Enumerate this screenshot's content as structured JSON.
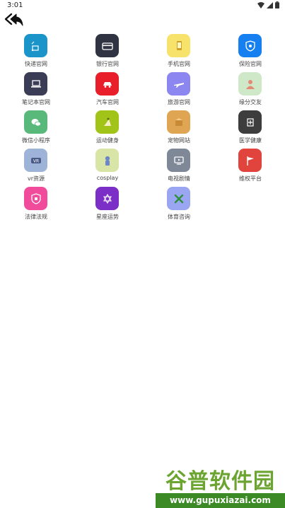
{
  "statusbar": {
    "time": "3:01"
  },
  "colors": {
    "accent_green": "#6ca431",
    "watermark_bar": "#3c8a26"
  },
  "grid": {
    "rows": [
      [
        {
          "label": "快递官网",
          "icon": "delivery-icon",
          "color": "#1b95c9"
        },
        {
          "label": "银行官网",
          "icon": "card-icon",
          "color": "#2f3342"
        },
        {
          "label": "手机官网",
          "icon": "phone-icon",
          "color": "#f7e36b"
        },
        {
          "label": "保险官网",
          "icon": "shield-icon",
          "color": "#1680f0"
        }
      ],
      [
        {
          "label": "笔记本官网",
          "icon": "laptop-icon",
          "color": "#3a3d55"
        },
        {
          "label": "汽车官网",
          "icon": "car-icon",
          "color": "#e81f2a"
        },
        {
          "label": "旅游官网",
          "icon": "plane-icon",
          "color": "#8b86f0"
        },
        {
          "label": "缘分交友",
          "icon": "friends-icon",
          "color": "#cfe8c8"
        }
      ],
      [
        {
          "label": "微信小程序",
          "icon": "wechat-icon",
          "color": "#59b97a"
        },
        {
          "label": "运动健身",
          "icon": "fitness-icon",
          "color": "#a2c318"
        },
        {
          "label": "宠物网站",
          "icon": "pet-icon",
          "color": "#e0a552"
        },
        {
          "label": "医学健康",
          "icon": "medical-icon",
          "color": "#3d3d3d"
        }
      ],
      [
        {
          "label": "vr资源",
          "icon": "vr-icon",
          "color": "#9db3d8"
        },
        {
          "label": "cosplay",
          "icon": "cosplay-icon",
          "color": "#d8e5a6"
        },
        {
          "label": "电视剧情",
          "icon": "tv-icon",
          "color": "#7e8897"
        },
        {
          "label": "维权平台",
          "icon": "flag-icon",
          "color": "#e0443c"
        }
      ],
      [
        {
          "label": "法律法规",
          "icon": "law-icon",
          "color": "#f04c9b"
        },
        {
          "label": "星座运势",
          "icon": "star-icon",
          "color": "#7c2fc7"
        },
        {
          "label": "体育咨询",
          "icon": "sports-icon",
          "color": "#9aa6f2"
        }
      ]
    ]
  },
  "watermark": {
    "text_cn": "谷普软件园",
    "url": "www.gupuxiazai.com"
  }
}
